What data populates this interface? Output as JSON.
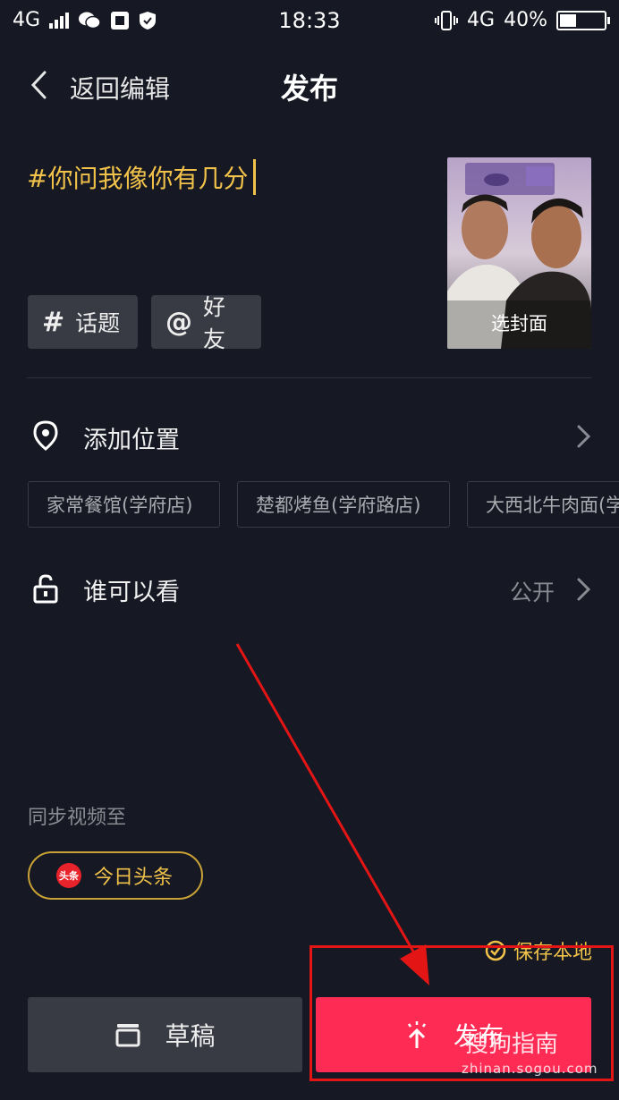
{
  "status_bar": {
    "network_left": "4G",
    "time": "18:33",
    "network_right": "4G",
    "battery": "40%",
    "battery_level": 0.4
  },
  "header": {
    "back_label": "返回编辑",
    "title": "发布"
  },
  "caption": {
    "text": "#你问我像你有几分"
  },
  "cover": {
    "label": "选封面"
  },
  "chips": {
    "topic_symbol": "#",
    "topic_label": "话题",
    "friend_symbol": "@",
    "friend_label": "好友"
  },
  "location": {
    "label": "添加位置",
    "suggestions": [
      "家常餐馆(学府店)",
      "楚都烤鱼(学府路店)",
      "大西北牛肉面(学"
    ]
  },
  "privacy": {
    "label": "谁可以看",
    "value": "公开"
  },
  "sync": {
    "label": "同步视频至",
    "toutiao_logo": "头条",
    "toutiao_label": "今日头条"
  },
  "save_local": {
    "label": "保存本地"
  },
  "buttons": {
    "draft_label": "草稿",
    "publish_label": "发布"
  },
  "watermark": {
    "brand": "搜狗指南",
    "url": "zhinan.sogou.com"
  },
  "colors": {
    "background": "#161823",
    "accent_yellow": "#f1c24a",
    "publish_red": "#fe2c55",
    "annotation_red": "#e31515"
  }
}
